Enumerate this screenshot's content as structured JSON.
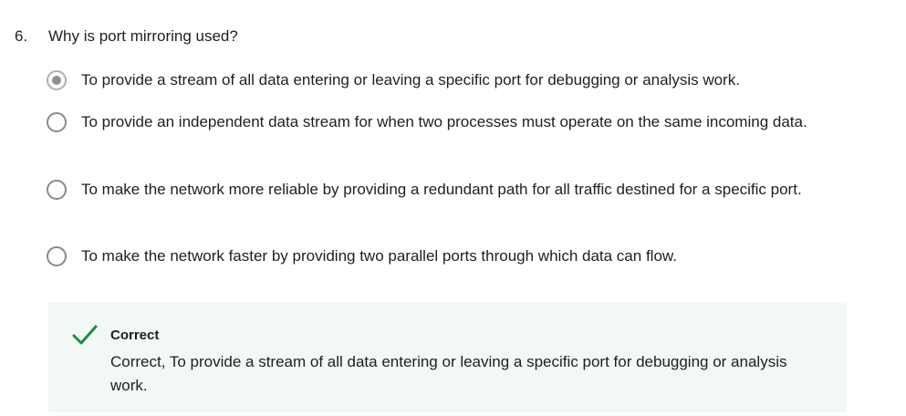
{
  "question": {
    "number": "6.",
    "text": "Why is port mirroring used?",
    "options": [
      {
        "label": "To provide a stream of all data entering or leaving a specific port for debugging or analysis work.",
        "selected": true
      },
      {
        "label": "To provide an independent data stream for when two processes must operate on the same incoming data.",
        "selected": false
      },
      {
        "label": "To make the network more reliable by providing a redundant path for all traffic destined for a specific port.",
        "selected": false
      },
      {
        "label": "To make the network faster by providing two parallel ports through which data can flow.",
        "selected": false
      }
    ]
  },
  "feedback": {
    "icon": "checkmark-icon",
    "title": "Correct",
    "text": "Correct, To provide a stream of all data entering or leaving a specific port for debugging or analysis work.",
    "accent_color": "#1f8a4c",
    "background_color": "#f2f8f6"
  }
}
